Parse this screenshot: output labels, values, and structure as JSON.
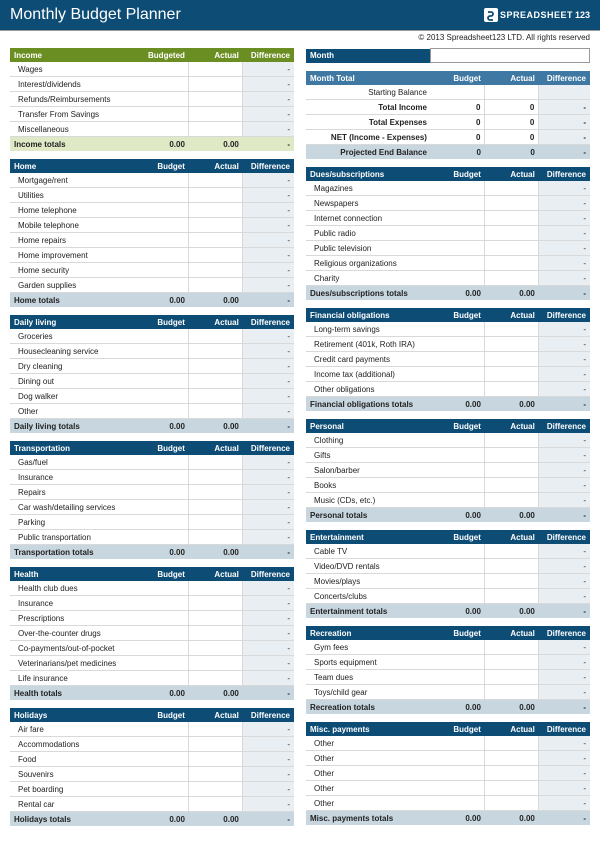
{
  "title": "Monthly Budget Planner",
  "logo_text": "SPREADSHEET",
  "logo_num": "123",
  "copyright": "© 2013 Spreadsheet123 LTD. All rights reserved",
  "cols": {
    "budgeted": "Budgeted",
    "budget": "Budget",
    "actual": "Actual",
    "diff": "Difference"
  },
  "totals_suffix": "totals",
  "dash": "-",
  "zero": "0",
  "zero2": "0.00",
  "month": {
    "label": "Month",
    "total": "Month Total",
    "rows": [
      "Starting Balance",
      "Total Income",
      "Total Expenses",
      "NET (Income - Expenses)"
    ],
    "projected": "Projected End Balance"
  },
  "left": [
    {
      "key": "income",
      "title": "Income",
      "header_budget": "Budgeted",
      "items": [
        "Wages",
        "Interest/dividends",
        "Refunds/Reimbursements",
        "Transfer From Savings",
        "Miscellaneous"
      ],
      "totals": "Income totals"
    },
    {
      "key": "home",
      "title": "Home",
      "items": [
        "Mortgage/rent",
        "Utilities",
        "Home telephone",
        "Mobile telephone",
        "Home repairs",
        "Home improvement",
        "Home security",
        "Garden supplies"
      ],
      "totals": "Home totals"
    },
    {
      "key": "daily",
      "title": "Daily living",
      "items": [
        "Groceries",
        "Housecleaning service",
        "Dry cleaning",
        "Dining out",
        "Dog walker",
        "Other"
      ],
      "totals": "Daily living totals"
    },
    {
      "key": "transport",
      "title": "Transportation",
      "items": [
        "Gas/fuel",
        "Insurance",
        "Repairs",
        "Car wash/detailing services",
        "Parking",
        "Public transportation"
      ],
      "totals": "Transportation totals"
    },
    {
      "key": "health",
      "title": "Health",
      "items": [
        "Health club dues",
        "Insurance",
        "Prescriptions",
        "Over-the-counter drugs",
        "Co-payments/out-of-pocket",
        "Veterinarians/pet medicines",
        "Life insurance"
      ],
      "totals": "Health totals"
    },
    {
      "key": "holidays",
      "title": "Holidays",
      "items": [
        "Air fare",
        "Accommodations",
        "Food",
        "Souvenirs",
        "Pet boarding",
        "Rental car"
      ],
      "totals": "Holidays totals"
    }
  ],
  "right": [
    {
      "key": "dues",
      "title": "Dues/subscriptions",
      "items": [
        "Magazines",
        "Newspapers",
        "Internet connection",
        "Public radio",
        "Public television",
        "Religious organizations",
        "Charity"
      ],
      "totals": "Dues/subscriptions totals"
    },
    {
      "key": "fin",
      "title": "Financial obligations",
      "items": [
        "Long-term savings",
        "Retirement (401k, Roth IRA)",
        "Credit card payments",
        "Income tax (additional)",
        "Other obligations"
      ],
      "totals": "Financial obligations totals"
    },
    {
      "key": "personal",
      "title": "Personal",
      "items": [
        "Clothing",
        "Gifts",
        "Salon/barber",
        "Books",
        "Music (CDs, etc.)"
      ],
      "totals": "Personal totals"
    },
    {
      "key": "ent",
      "title": "Entertainment",
      "items": [
        "Cable TV",
        "Video/DVD rentals",
        "Movies/plays",
        "Concerts/clubs"
      ],
      "totals": "Entertainment totals"
    },
    {
      "key": "rec",
      "title": "Recreation",
      "items": [
        "Gym fees",
        "Sports equipment",
        "Team dues",
        "Toys/child gear"
      ],
      "totals": "Recreation totals"
    },
    {
      "key": "misc",
      "title": "Misc. payments",
      "items": [
        "Other",
        "Other",
        "Other",
        "Other",
        "Other"
      ],
      "totals": "Misc. payments totals"
    }
  ]
}
